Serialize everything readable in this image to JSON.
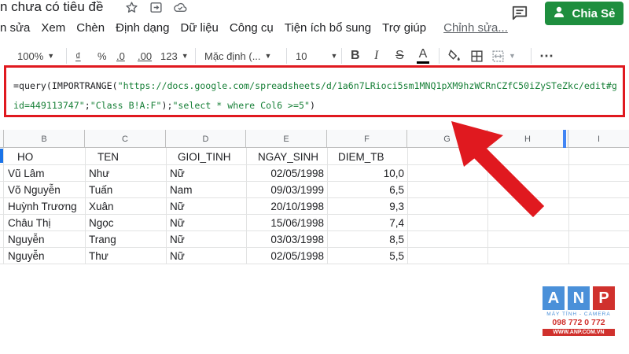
{
  "title_bar": {
    "doc_title": "n chưa có tiêu đề",
    "share_label": "Chia Sẻ"
  },
  "menu": {
    "items": [
      "n sửa",
      "Xem",
      "Chèn",
      "Định dạng",
      "Dữ liệu",
      "Công cụ",
      "Tiện ích bổ sung",
      "Trợ giúp"
    ],
    "edit_link": "Chỉnh sửa..."
  },
  "toolbar": {
    "zoom": "100%",
    "currency": "₫",
    "percent": "%",
    "decrease_decimal": ".0",
    "increase_decimal": ".00",
    "number_format": "123",
    "font": "Mặc định (...",
    "font_size": "10",
    "bold": "B",
    "italic": "I",
    "strikethrough": "S",
    "text_color": "A",
    "more": "⋯"
  },
  "formula": {
    "prefix": "=query(IMPORTRANGE(",
    "url": "\"https://docs.google.com/spreadsheets/d/1a6n7LRioci5sm1MNQ1pXM9hzWCRnCZfC50iZySTeZkc/edit#gid=449113747\"",
    "sep": ";",
    "range": "\"Class B!A:F\"",
    "mid": ");",
    "query": "\"select * where Col6 >=5\"",
    "suffix": ")"
  },
  "grid": {
    "columns": [
      "B",
      "C",
      "D",
      "E",
      "F",
      "G",
      "H",
      "I"
    ],
    "header_row": [
      "HO",
      "TEN",
      "GIOI_TINH",
      "NGAY_SINH",
      "DIEM_TB"
    ],
    "rows": [
      [
        "Vũ Lâm",
        "Như",
        "Nữ",
        "02/05/1998",
        "10,0"
      ],
      [
        "Võ Nguyễn",
        "Tuấn",
        "Nam",
        "09/03/1999",
        "6,5"
      ],
      [
        "Huỳnh Trương",
        "Xuân",
        "Nữ",
        "20/10/1998",
        "9,3"
      ],
      [
        "Châu Thị",
        "Ngọc",
        "Nữ",
        "15/06/1998",
        "7,4"
      ],
      [
        "Nguyễn",
        "Trang",
        "Nữ",
        "03/03/1998",
        "8,5"
      ],
      [
        "Nguyễn",
        "Thư",
        "Nữ",
        "02/05/1998",
        "5,5"
      ]
    ]
  },
  "watermark": {
    "letters": [
      "A",
      "N",
      "P"
    ],
    "subtitle": "MÁY TÍNH - CAMERA",
    "phone": "098 772 0 772",
    "website": "WWW.ANP.COM.VN"
  },
  "colors": {
    "highlight_border": "#e0191f",
    "share_green": "#1e8e3e",
    "formula_string": "#188038",
    "arrow_red": "#e0191f",
    "anp_blue": "#4a90d9",
    "anp_red": "#d0312d"
  },
  "icons": {
    "star": "star-icon",
    "move": "move-to-folder-icon",
    "cloud": "cloud-saved-icon",
    "comment": "comment-icon",
    "share_person": "person-icon"
  }
}
